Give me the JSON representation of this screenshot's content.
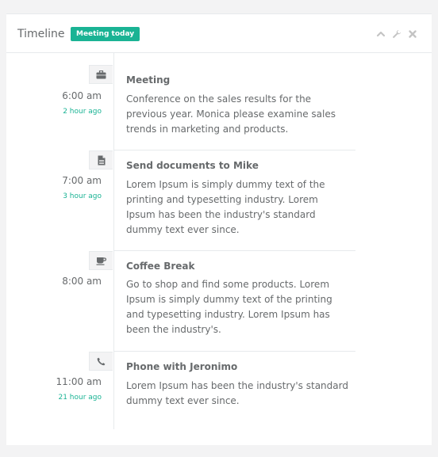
{
  "panel": {
    "title": "Timeline",
    "badge": "Meeting today",
    "badge_color": "#1ab394",
    "tools": [
      "chevron-up-icon",
      "wrench-icon",
      "close-icon"
    ]
  },
  "timeline": [
    {
      "icon": "briefcase-icon",
      "time": "6:00 am",
      "ago": "2 hour ago",
      "title": "Meeting",
      "text": "Conference on the sales results for the previous year. Monica please examine sales trends in marketing and products."
    },
    {
      "icon": "file-icon",
      "time": "7:00 am",
      "ago": "3 hour ago",
      "title": "Send documents to Mike",
      "text": "Lorem Ipsum is simply dummy text of the printing and typesetting industry. Lorem Ipsum has been the industry's standard dummy text ever since."
    },
    {
      "icon": "coffee-icon",
      "time": "8:00 am",
      "ago": "",
      "title": "Coffee Break",
      "text": "Go to shop and find some products. Lorem Ipsum is simply dummy text of the printing and typesetting industry. Lorem Ipsum has been the industry's."
    },
    {
      "icon": "phone-icon",
      "time": "11:00 am",
      "ago": "21 hour ago",
      "title": "Phone with Jeronimo",
      "text": "Lorem Ipsum has been the industry's standard dummy text ever since."
    }
  ]
}
